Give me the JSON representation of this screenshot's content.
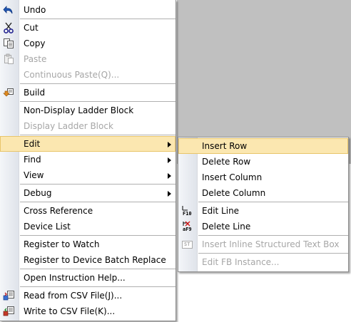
{
  "main_menu": {
    "items": [
      {
        "label": "Undo",
        "icon": "undo-icon",
        "enabled": true
      },
      {
        "label": "Cut",
        "icon": "cut-icon",
        "enabled": true
      },
      {
        "label": "Copy",
        "icon": "copy-icon",
        "enabled": true
      },
      {
        "label": "Paste",
        "icon": "paste-icon",
        "enabled": false
      },
      {
        "label": "Continuous Paste(Q)...",
        "enabled": false
      },
      {
        "label": "Build",
        "icon": "build-icon",
        "enabled": true
      },
      {
        "label": "Non-Display Ladder Block",
        "enabled": true
      },
      {
        "label": "Display Ladder Block",
        "enabled": false
      },
      {
        "label": "Edit",
        "enabled": true,
        "submenu": true,
        "highlighted": true
      },
      {
        "label": "Find",
        "enabled": true,
        "submenu": true
      },
      {
        "label": "View",
        "enabled": true,
        "submenu": true
      },
      {
        "label": "Debug",
        "enabled": true,
        "submenu": true
      },
      {
        "label": "Cross Reference",
        "enabled": true
      },
      {
        "label": "Device List",
        "enabled": true
      },
      {
        "label": "Register to Watch",
        "enabled": true
      },
      {
        "label": "Register to Device Batch Replace",
        "enabled": true
      },
      {
        "label": "Open Instruction Help...",
        "enabled": true
      },
      {
        "label": "Read from CSV File(J)...",
        "icon": "read-csv-icon",
        "enabled": true
      },
      {
        "label": "Write to CSV File(K)...",
        "icon": "write-csv-icon",
        "enabled": true
      }
    ]
  },
  "edit_submenu": {
    "items": [
      {
        "label": "Insert Row",
        "enabled": true,
        "highlighted": true
      },
      {
        "label": "Delete Row",
        "enabled": true
      },
      {
        "label": "Insert Column",
        "enabled": true
      },
      {
        "label": "Delete Column",
        "enabled": true
      },
      {
        "label": "Edit Line",
        "icon": "edit-line-icon",
        "icon_text": "F10",
        "enabled": true
      },
      {
        "label": "Delete Line",
        "icon": "delete-line-icon",
        "icon_text": "aF9",
        "enabled": true
      },
      {
        "label": "Insert Inline Structured Text Box",
        "icon": "inline-st-icon",
        "icon_text": "ST",
        "enabled": false
      },
      {
        "label": "Edit FB Instance...",
        "enabled": false
      }
    ]
  },
  "colors": {
    "highlight": "#fbe7b0",
    "highlight_border": "#e8c56b",
    "disabled_text": "#a6a6a6",
    "background_gray": "#c0c0c0"
  }
}
